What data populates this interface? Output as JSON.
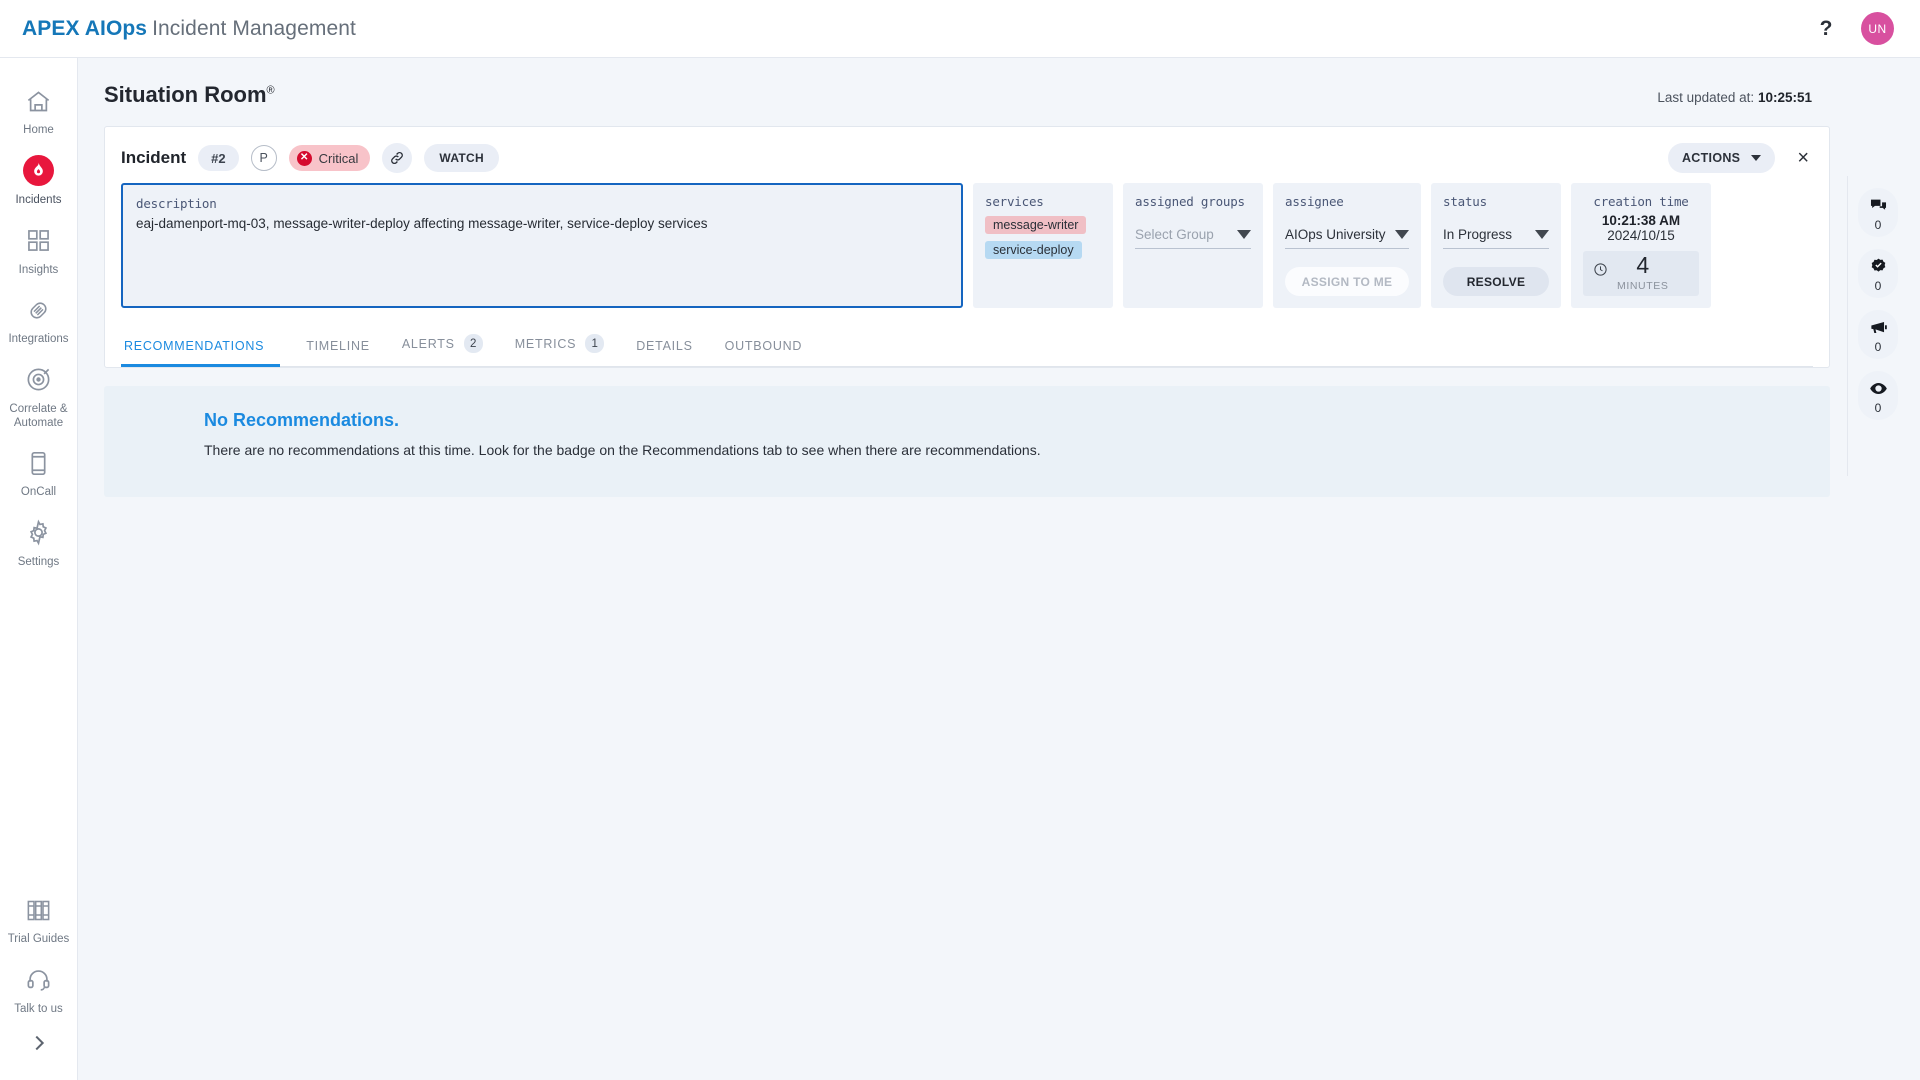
{
  "topbar": {
    "brand_primary": "APEX AIOps",
    "brand_secondary": "Incident Management",
    "help_label": "?",
    "avatar_initials": "UN"
  },
  "sidebar": {
    "items": [
      {
        "label": "Home",
        "icon": "home-icon"
      },
      {
        "label": "Incidents",
        "icon": "flame-icon",
        "active": true
      },
      {
        "label": "Insights",
        "icon": "grid-icon"
      },
      {
        "label": "Integrations",
        "icon": "integrations-icon"
      },
      {
        "label": "Correlate & Automate",
        "icon": "target-icon"
      },
      {
        "label": "OnCall",
        "icon": "phone-icon"
      },
      {
        "label": "Settings",
        "icon": "gear-icon"
      },
      {
        "label": "Trial Guides",
        "icon": "books-icon"
      },
      {
        "label": "Talk to us",
        "icon": "headset-icon"
      }
    ],
    "expand_icon": "chevron-right-icon"
  },
  "page": {
    "title": "Situation Room",
    "title_mark": "®",
    "last_updated_label": "Last updated at:",
    "last_updated_time": "10:25:51"
  },
  "incident": {
    "title": "Incident",
    "number": "#2",
    "priority": "P",
    "severity": "Critical",
    "severity_icon": "error-circle-icon",
    "link_icon": "link-icon",
    "watch_label": "WATCH",
    "actions_label": "ACTIONS",
    "close_label": "×",
    "description_label": "description",
    "description_value": "eaj-damenport-mq-03, message-writer-deploy affecting message-writer, service-deploy services"
  },
  "panels": {
    "services": {
      "label": "services",
      "chips": [
        {
          "name": "message-writer",
          "color": "#f0bfc5"
        },
        {
          "name": "service-deploy",
          "color": "#b6d9f2"
        }
      ]
    },
    "assigned_groups": {
      "label": "assigned groups",
      "placeholder": "Select Group",
      "value": "Select Group"
    },
    "assignee": {
      "label": "assignee",
      "value": "AIOps University",
      "button_label": "ASSIGN TO ME"
    },
    "status": {
      "label": "status",
      "value": "In Progress",
      "button_label": "RESOLVE"
    },
    "creation_time": {
      "label": "creation time",
      "time": "10:21:38 AM",
      "date": "2024/10/15",
      "elapsed_value": "4",
      "elapsed_unit": "MINUTES",
      "clock_icon": "clock-icon"
    }
  },
  "tabs": [
    {
      "label": "RECOMMENDATIONS",
      "badge": "",
      "active": true
    },
    {
      "label": "TIMELINE",
      "badge": ""
    },
    {
      "label": "ALERTS",
      "badge": "2"
    },
    {
      "label": "METRICS",
      "badge": "1"
    },
    {
      "label": "DETAILS",
      "badge": ""
    },
    {
      "label": "OUTBOUND",
      "badge": ""
    }
  ],
  "empty_state": {
    "title": "No Recommendations.",
    "text": "There are no recommendations at this time. Look for the badge on the Recommendations tab to see when there are recommendations."
  },
  "rail": [
    {
      "icon": "chat-icon",
      "count": "0"
    },
    {
      "icon": "check-badge-icon",
      "count": "0"
    },
    {
      "icon": "megaphone-icon",
      "count": "0"
    },
    {
      "icon": "eye-icon",
      "count": "0"
    }
  ],
  "colors": {
    "brand_blue": "#1577b8",
    "accent_blue": "#1b8ae0",
    "critical_red": "#d50a2e",
    "incidents_red": "#e8173d",
    "avatar_pink": "#d8509f",
    "focus_border": "#1565c0"
  }
}
